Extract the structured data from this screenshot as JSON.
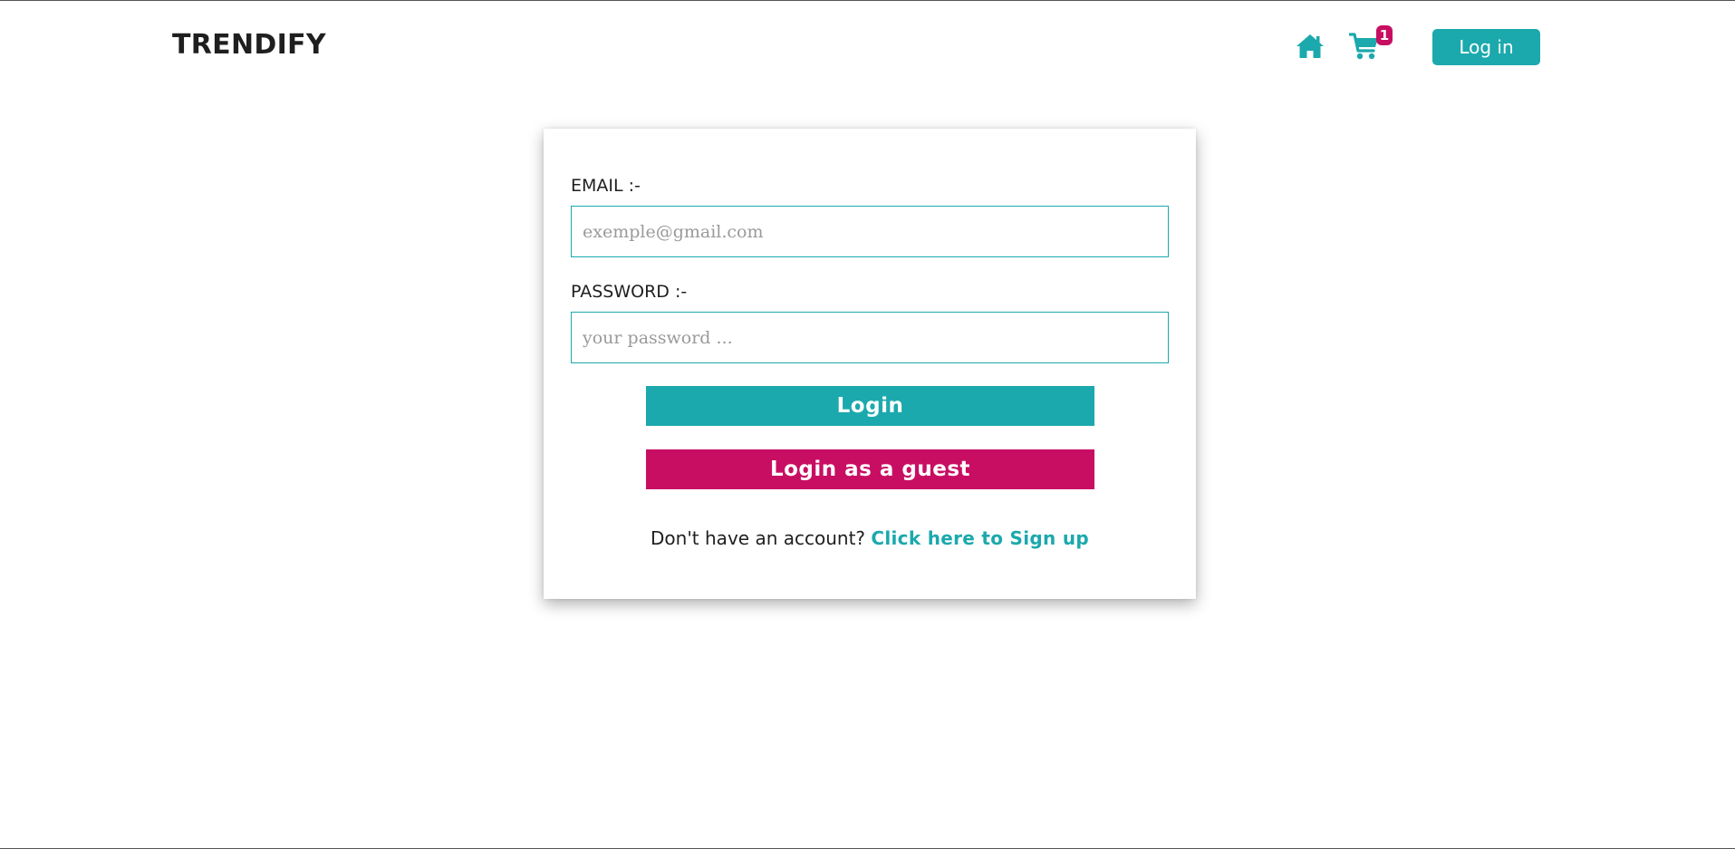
{
  "header": {
    "brand": "TRENDIFY",
    "cart_count": "1",
    "login_button": "Log in",
    "icons": [
      "home-icon",
      "cart-icon"
    ]
  },
  "form": {
    "email_label": "EMAIL :-",
    "email_placeholder": "exemple@gmail.com",
    "email_value": "",
    "password_label": "PASSWORD :-",
    "password_placeholder": "your password ...",
    "password_value": "",
    "login_button": "Login",
    "guest_button": "Login as a guest",
    "signup_prompt": "Don't have an account?",
    "signup_link": "Click here to Sign up"
  },
  "colors": {
    "accent": "#1ba9ad",
    "guest": "#c80e63",
    "badge": "#c80e63",
    "text": "#1f1f1f"
  }
}
